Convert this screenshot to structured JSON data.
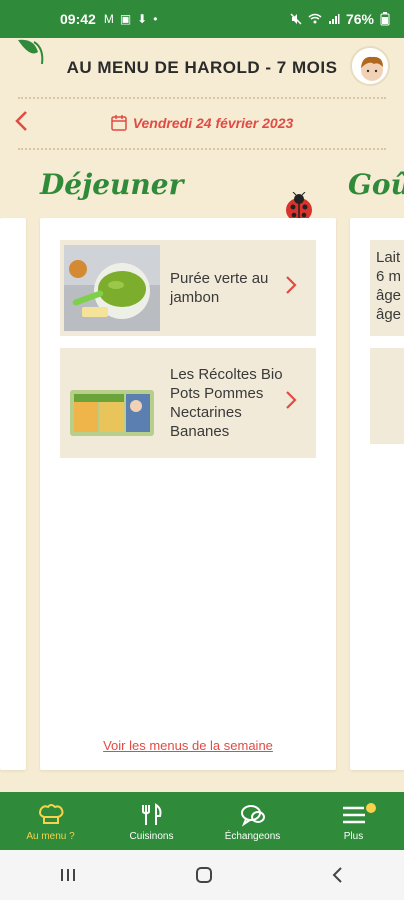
{
  "status": {
    "time": "09:42",
    "icons": [
      "M",
      "▣",
      "⬇",
      "•"
    ],
    "right": "76%"
  },
  "header": {
    "title": "AU MENU DE HAROLD - 7 MOIS"
  },
  "date_nav": {
    "date": "Vendredi 24 février 2023"
  },
  "meals": {
    "current": "Déjeuner",
    "next_partial": "Goût"
  },
  "items": [
    {
      "name": "Purée verte au jambon"
    },
    {
      "name": "Les Récoltes Bio Pots Pommes Nectarines Bananes"
    }
  ],
  "right_card_snippet": [
    "Lait",
    "6 m",
    "âge",
    "âge"
  ],
  "week_link": "Voir les menus de la semaine",
  "bottom_nav": [
    {
      "label": "Au menu ?"
    },
    {
      "label": "Cuisinons"
    },
    {
      "label": "Échangeons"
    },
    {
      "label": "Plus"
    }
  ],
  "colors": {
    "primary_green": "#2f8a3a",
    "accent_red": "#e14b43",
    "badge_yellow": "#f8d24a",
    "bg": "#f6ecd3"
  }
}
